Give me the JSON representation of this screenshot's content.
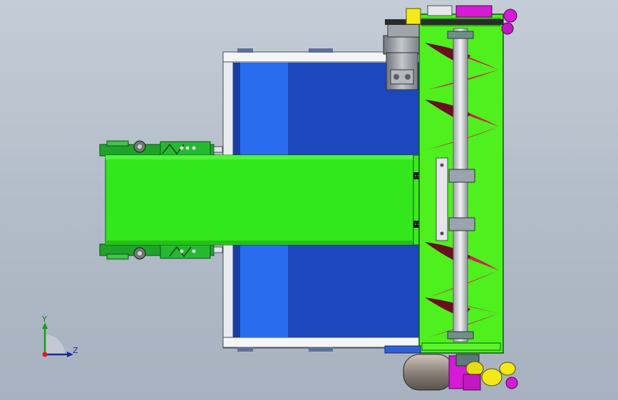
{
  "viewport": {
    "background_top": "#c4ccd6",
    "background_bottom": "#a7b1bf"
  },
  "colors": {
    "hopper_blue": "#1f4fc9",
    "hopper_light_blue": "#2a6cf0",
    "conveyor_green": "#32e81b",
    "auger_housing_green": "#4ef01e",
    "flight_red": "#d0224f",
    "flight_dark": "#6b0f1e",
    "frame_white": "#eef0f4",
    "motor_gray": "#8c9097",
    "yellow_part": "#f2ea17",
    "magenta_part": "#d61ad6"
  },
  "triad": {
    "y_label": "Y",
    "z_label": "Z",
    "icon": "coordinate-triad-icon"
  }
}
